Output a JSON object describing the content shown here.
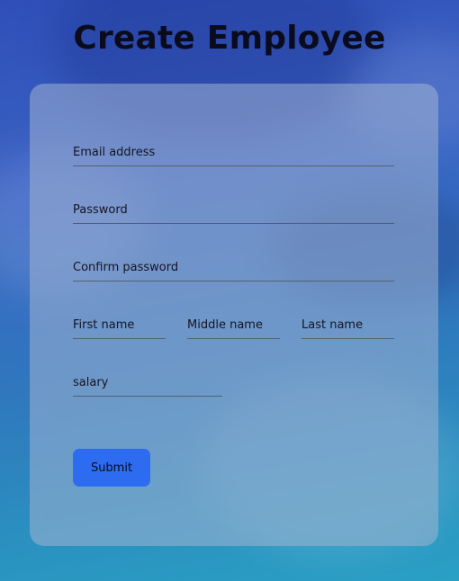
{
  "header": {
    "title": "Create Employee"
  },
  "form": {
    "email": {
      "value": "",
      "placeholder": "Email address"
    },
    "password": {
      "value": "",
      "placeholder": "Password"
    },
    "confirm_password": {
      "value": "",
      "placeholder": "Confirm password"
    },
    "first_name": {
      "value": "",
      "placeholder": "First name"
    },
    "middle_name": {
      "value": "",
      "placeholder": "Middle name"
    },
    "last_name": {
      "value": "",
      "placeholder": "Last name"
    },
    "salary": {
      "value": "",
      "placeholder": "salary"
    },
    "submit_label": "Submit"
  },
  "colors": {
    "submit_button": "#2d6cf0",
    "background_top": "#2f4fb8",
    "background_bottom": "#2aa0c4"
  }
}
